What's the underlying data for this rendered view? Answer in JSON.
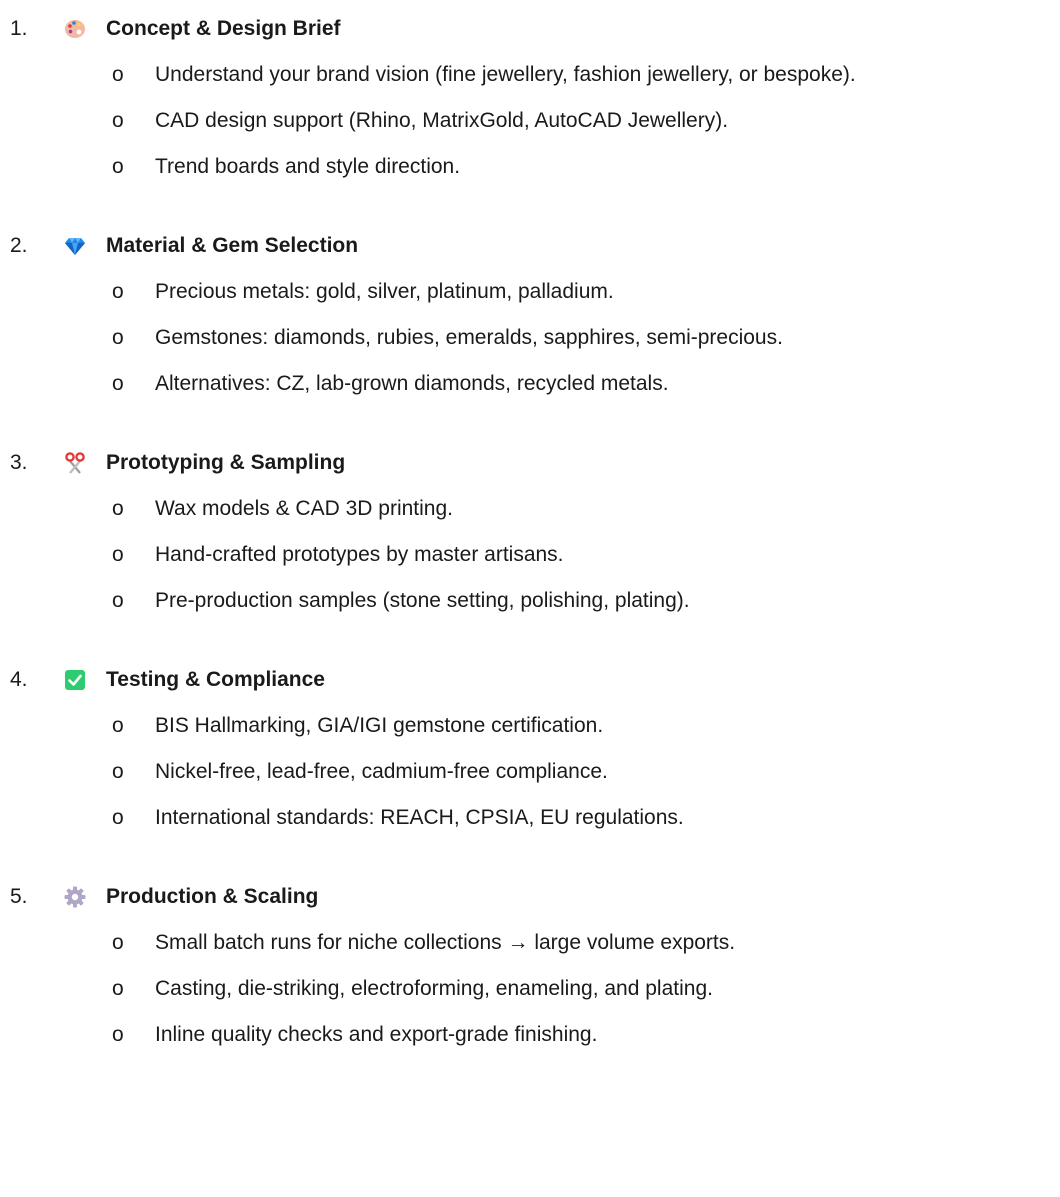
{
  "steps": [
    {
      "number": "1.",
      "icon": "palette-icon",
      "title": "Concept & Design Brief",
      "bullets": [
        "Understand your brand vision (fine jewellery, fashion jewellery, or bespoke).",
        "CAD design support (Rhino, MatrixGold, AutoCAD Jewellery).",
        "Trend boards and style direction."
      ]
    },
    {
      "number": "2.",
      "icon": "gem-icon",
      "title": "Material & Gem Selection",
      "bullets": [
        "Precious metals: gold, silver, platinum, palladium.",
        "Gemstones: diamonds, rubies, emeralds, sapphires, semi-precious.",
        "Alternatives: CZ, lab-grown diamonds, recycled metals."
      ]
    },
    {
      "number": "3.",
      "icon": "scissors-icon",
      "title": "Prototyping & Sampling",
      "bullets": [
        "Wax models & CAD 3D printing.",
        "Hand-crafted prototypes by master artisans.",
        "Pre-production samples (stone setting, polishing, plating)."
      ]
    },
    {
      "number": "4.",
      "icon": "check-box-icon",
      "title": "Testing & Compliance",
      "bullets": [
        "BIS Hallmarking, GIA/IGI gemstone certification.",
        "Nickel-free, lead-free, cadmium-free compliance.",
        "International standards: REACH, CPSIA, EU regulations."
      ]
    },
    {
      "number": "5.",
      "icon": "gear-icon",
      "title": "Production & Scaling",
      "bullets": [
        "Small batch runs for niche collections → large volume exports.",
        "Casting, die-striking, electroforming, enameling, and plating.",
        "Inline quality checks and export-grade finishing."
      ]
    }
  ],
  "bullet_marker": "o",
  "colors": {
    "text": "#1a1a1a",
    "check_green": "#2ecc71",
    "gem_blue": "#1e88e5",
    "scissors_red": "#e53935",
    "gear_gray": "#b0a6c8",
    "palette_peach": "#f4b7a2"
  }
}
